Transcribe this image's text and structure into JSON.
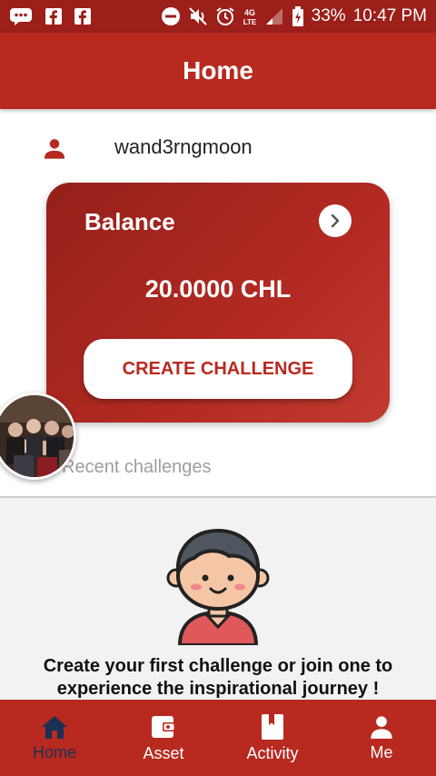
{
  "status_bar": {
    "battery": "33%",
    "time": "10:47 PM",
    "network": "4G LTE"
  },
  "header": {
    "title": "Home"
  },
  "user": {
    "username": "wand3rngmoon"
  },
  "balance_card": {
    "label": "Balance",
    "amount": "20.0000 CHL",
    "create_button": "CREATE CHALLENGE"
  },
  "recent": {
    "label": "Recent challenges"
  },
  "empty_state": {
    "message": "Create your first challenge or join one to experience the inspirational journey !"
  },
  "bottom_nav": {
    "items": [
      {
        "label": "Home",
        "icon": "home-icon",
        "active": true
      },
      {
        "label": "Asset",
        "icon": "wallet-icon",
        "active": false
      },
      {
        "label": "Activity",
        "icon": "book-icon",
        "active": false
      },
      {
        "label": "Me",
        "icon": "person-icon",
        "active": false
      }
    ]
  },
  "colors": {
    "primary": "#b8291f",
    "status_bar": "#9c1f1a",
    "active_nav": "#1c2f54"
  }
}
